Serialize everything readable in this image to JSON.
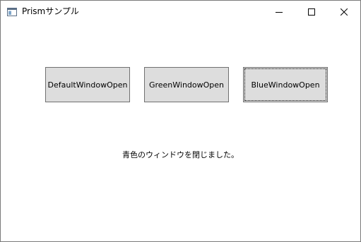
{
  "window": {
    "title": "Prismサンプル",
    "icon": "app-window-icon",
    "controls": {
      "minimize": "minimize-icon",
      "maximize": "maximize-icon",
      "close": "close-icon"
    }
  },
  "main": {
    "buttons": [
      {
        "label": "DefaultWindowOpen",
        "focused": false
      },
      {
        "label": "GreenWindowOpen",
        "focused": false
      },
      {
        "label": "BlueWindowOpen",
        "focused": true
      }
    ],
    "status_message": "青色のウィンドウを閉じました。"
  },
  "colors": {
    "button_face": "#dddddd",
    "button_border": "#707070",
    "window_border": "#7a7a7a"
  }
}
